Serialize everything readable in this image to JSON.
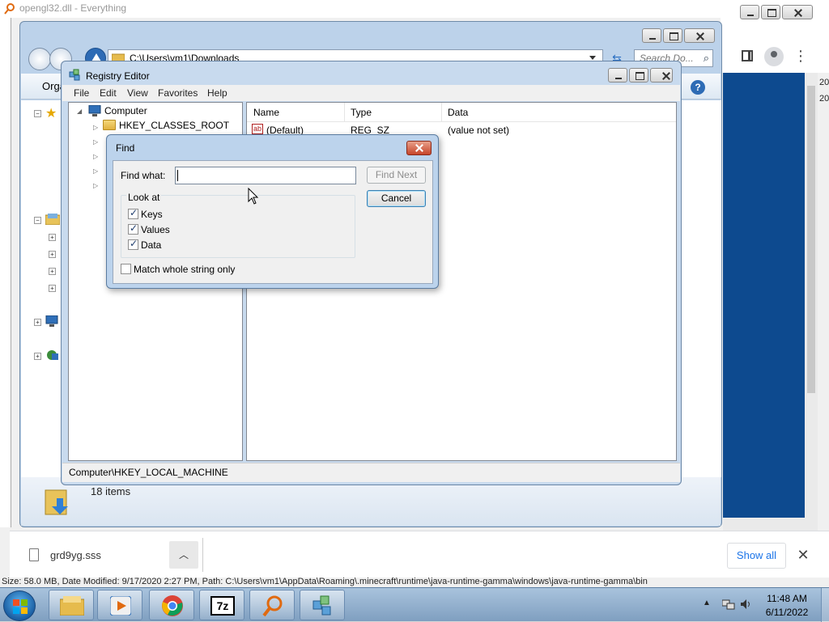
{
  "background_window": {
    "title": "opengl32.dll - Everything"
  },
  "explorer": {
    "address": "C:\\Users\\vm1\\Downloads",
    "search_placeholder": "Search Do...",
    "organize_label": "Orga",
    "item_count": "18 items"
  },
  "regedit": {
    "title": "Registry Editor",
    "menu": [
      "File",
      "Edit",
      "View",
      "Favorites",
      "Help"
    ],
    "tree": {
      "root": "Computer",
      "first_key": "HKEY_CLASSES_ROOT"
    },
    "columns": [
      "Name",
      "Type",
      "Data"
    ],
    "rows": [
      {
        "name": "(Default)",
        "type": "REG_SZ",
        "data": "(value not set)"
      }
    ],
    "status": "Computer\\HKEY_LOCAL_MACHINE"
  },
  "find_dialog": {
    "title": "Find",
    "find_what_label": "Find what:",
    "find_what_value": "",
    "find_next_label": "Find Next",
    "cancel_label": "Cancel",
    "look_at_label": "Look at",
    "options": [
      {
        "label": "Keys",
        "checked": true
      },
      {
        "label": "Values",
        "checked": true
      },
      {
        "label": "Data",
        "checked": true
      }
    ],
    "match_whole_label": "Match whole string only",
    "match_whole_checked": false
  },
  "download_bar": {
    "file_name": "grd9yg.sss",
    "show_all_label": "Show all"
  },
  "status_strip": {
    "text": "Size: 58.0 MB, Date Modified: 9/17/2020 2:27 PM, Path: C:\\Users\\vm1\\AppData\\Roaming\\.minecraft\\runtime\\java-runtime-gamma\\windows\\java-runtime-gamma\\bin"
  },
  "taskbar": {
    "time": "11:48 AM",
    "date": "6/11/2022"
  },
  "colors": {
    "find_dialog_frame": "#bcd3ec",
    "regedit_frame": "#c8daee",
    "blue_area": "#0d4a8f",
    "show_all_text": "#1a73e8"
  }
}
